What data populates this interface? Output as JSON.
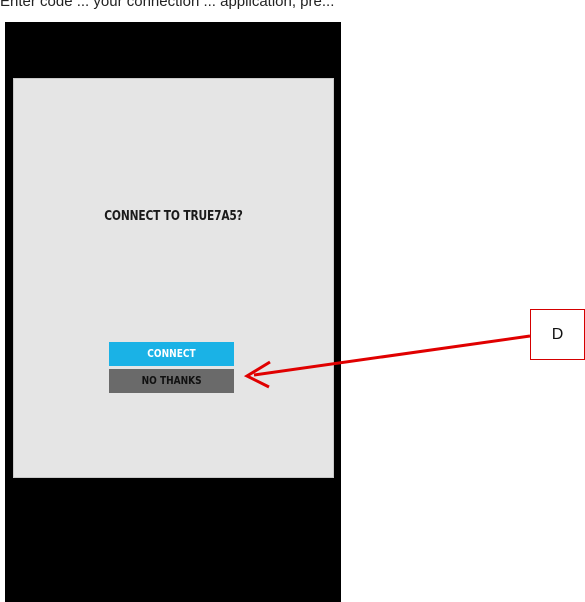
{
  "document": {
    "caption_fragment": "Enter code ... your connection ... application, pre..."
  },
  "dialog": {
    "title": "CONNECT TO TRUE7A5?",
    "connect_label": "CONNECT",
    "no_thanks_label": "NO THANKS"
  },
  "callout": {
    "label": "D"
  },
  "colors": {
    "connect_button": "#1ab2e6",
    "no_thanks_button": "#6a6a6a",
    "dialog_background": "#e5e5e5",
    "screen_background": "#000000",
    "annotation": "#e00000"
  }
}
